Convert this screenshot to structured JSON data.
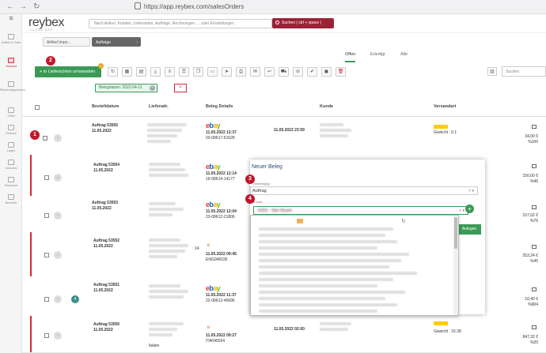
{
  "browser": {
    "back": "←",
    "forward": "→",
    "reload": "↻",
    "url": "https://app.reybex.com/salesOrders"
  },
  "app": {
    "logo": "reybex",
    "tagline": "CLOUD ERP"
  },
  "search": {
    "placeholder": "Nach Artikel, Kunden, Lieferanten, Aufträge, Rechnungen, ... oder Einstellungen",
    "button": "Suchen ( ctrl + space )"
  },
  "sidebar": {
    "items": [
      {
        "label": "Artikel & Sets",
        "icon": "cube-icon"
      },
      {
        "label": "Verkauf",
        "icon": "cart-icon"
      },
      {
        "label": "Rechnungswesen",
        "icon": "document-icon"
      },
      {
        "label": "CRM",
        "icon": "people-icon"
      },
      {
        "label": "Einkauf",
        "icon": "bag-icon"
      },
      {
        "label": "Lager",
        "icon": "warehouse-icon"
      },
      {
        "label": "Versand",
        "icon": "truck-icon"
      },
      {
        "label": "Finanzen",
        "icon": "money-icon"
      },
      {
        "label": "Berichte",
        "icon": "chart-icon"
      }
    ]
  },
  "tabs": [
    {
      "label": "Artikel Impo..."
    },
    {
      "label": "Aufträge"
    }
  ],
  "view_tabs": [
    {
      "label": "Offen"
    },
    {
      "label": "Erledigt"
    },
    {
      "label": "Alle"
    }
  ],
  "toolbar": {
    "convert_label": "In Lieferschein umwandeln",
    "badge": "1",
    "search_placeholder": "Suchen"
  },
  "filter": {
    "label": "Belegdatum: 2022-04-11"
  },
  "table": {
    "headers": [
      "Bestelldatum",
      "Lieferadr.",
      "Beleg Details",
      "Kunde",
      "Versandart"
    ]
  },
  "rows": [
    {
      "order": "Auftrag 53555",
      "date": "11.05.2022",
      "time": "11.05.2022 12:37",
      "ref": "03-08617-61628",
      "date2": "11.05.2022 23:59",
      "shipping": "Gewicht : 0.1",
      "amount": "34,00 €",
      "pct": "%100",
      "channel": "ebay",
      "checked": true
    },
    {
      "order": "Auftrag 53554",
      "date": "11.05.2022",
      "time": "11.05.2022 12:14",
      "ref": "16-08614-14177",
      "date2": "",
      "shipping": "",
      "amount": "150,00 €",
      "pct": "%46",
      "channel": "ebay",
      "checked": false
    },
    {
      "order": "Auftrag 53553",
      "date": "11.05.2022",
      "time": "11.05.2022 12:04",
      "ref": "23-08612-21806",
      "date2": "",
      "shipping": "",
      "amount": "157,62 €",
      "pct": "%76",
      "channel": "ebay",
      "checked": false
    },
    {
      "order": "Auftrag 53552",
      "date": "11.05.2022",
      "time": "11.05.2022 09:45",
      "ref": "ENG045035",
      "date2": "",
      "shipping": "",
      "amount": "253,24 €",
      "pct": "%45",
      "channel": "shop",
      "checked": false,
      "extra": "14"
    },
    {
      "order": "Auftrag 53551",
      "date": "11.05.2022",
      "time": "11.05.2022 11:37",
      "ref": "22-08612-45696",
      "date2": "",
      "shipping": "",
      "amount": "10,40 €",
      "pct": "%904",
      "channel": "ebay",
      "checked": false,
      "badge": "4"
    },
    {
      "order": "Auftrag 53550",
      "date": "11.05.2022",
      "time": "11.05.2022 09:27",
      "ref": "ITA045034",
      "date2": "11.05.2022 02:00",
      "shipping": "Gewicht : 15.38",
      "amount": "847,32 €",
      "pct": "%20",
      "channel": "shop",
      "checked": false,
      "country": "Italien"
    }
  ],
  "modal": {
    "title": "Neuer Beleg",
    "type_label": "Zielbelegtyp",
    "type_value": "Auftrag",
    "client_label": "Kunde",
    "client_value": "10001 - Max Muster",
    "create_label": "Anlegen"
  },
  "callouts": [
    "1",
    "2",
    "3",
    "4"
  ],
  "colors": {
    "brand": "#9b2237",
    "green": "#3a9a56",
    "red": "#d9263c",
    "callout": "#c0182c"
  }
}
